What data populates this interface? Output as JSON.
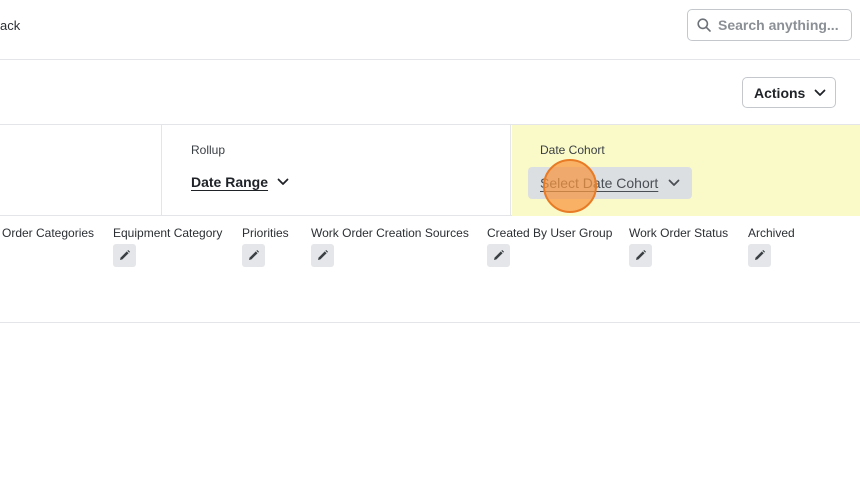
{
  "header": {
    "back_text": "ack",
    "search_placeholder": "Search anything..."
  },
  "toolbar": {
    "actions_label": "Actions"
  },
  "filters": {
    "rollup": {
      "label": "Rollup",
      "value": "Date Range"
    },
    "date_cohort": {
      "label": "Date Cohort",
      "value": "Select Date Cohort"
    }
  },
  "columns": [
    {
      "label": "Order Categories"
    },
    {
      "label": "Equipment Category"
    },
    {
      "label": "Priorities"
    },
    {
      "label": "Work Order Creation Sources"
    },
    {
      "label": "Created By User Group"
    },
    {
      "label": "Work Order Status"
    },
    {
      "label": "Archived"
    }
  ],
  "colors": {
    "highlight": "#fafac8",
    "click_marker": "#f7943e"
  },
  "icons": {
    "search": "search-icon",
    "chevron": "chevron-down-icon",
    "edit": "pencil-icon"
  }
}
